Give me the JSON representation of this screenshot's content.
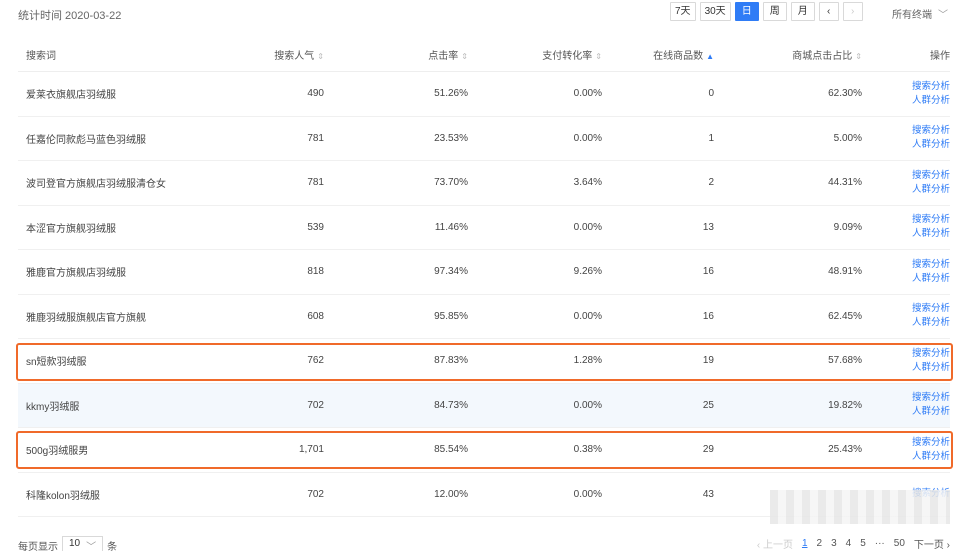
{
  "header": {
    "stat_time": "统计时间 2020-03-22",
    "ranges": [
      "7天",
      "30天",
      "日",
      "周",
      "月"
    ],
    "active_range": "日",
    "prev": "‹",
    "next": "›",
    "terminal": "所有终端"
  },
  "columns": {
    "keyword": "搜索词",
    "popularity": "搜索人气",
    "click_rate": "点击率",
    "pay_rate": "支付转化率",
    "online_products": "在线商品数",
    "mall_click": "商城点击占比",
    "ops": "操作"
  },
  "ops_links": {
    "search": "搜索分析",
    "crowd": "人群分析"
  },
  "rows": [
    {
      "keyword": "爱莱衣旗舰店羽绒服",
      "popularity": "490",
      "click_rate": "51.26%",
      "pay_rate": "0.00%",
      "products": "0",
      "mall": "62.30%"
    },
    {
      "keyword": "任嘉伦同款彪马蓝色羽绒服",
      "popularity": "781",
      "click_rate": "23.53%",
      "pay_rate": "0.00%",
      "products": "1",
      "mall": "5.00%"
    },
    {
      "keyword": "波司登官方旗舰店羽绒服清仓女",
      "popularity": "781",
      "click_rate": "73.70%",
      "pay_rate": "3.64%",
      "products": "2",
      "mall": "44.31%"
    },
    {
      "keyword": "本涩官方旗舰羽绒服",
      "popularity": "539",
      "click_rate": "11.46%",
      "pay_rate": "0.00%",
      "products": "13",
      "mall": "9.09%"
    },
    {
      "keyword": "雅鹿官方旗舰店羽绒服",
      "popularity": "818",
      "click_rate": "97.34%",
      "pay_rate": "9.26%",
      "products": "16",
      "mall": "48.91%"
    },
    {
      "keyword": "雅鹿羽绒服旗舰店官方旗舰",
      "popularity": "608",
      "click_rate": "95.85%",
      "pay_rate": "0.00%",
      "products": "16",
      "mall": "62.45%"
    },
    {
      "keyword": "sn短款羽绒服",
      "popularity": "762",
      "click_rate": "87.83%",
      "pay_rate": "1.28%",
      "products": "19",
      "mall": "57.68%"
    },
    {
      "keyword": "kkmy羽绒服",
      "popularity": "702",
      "click_rate": "84.73%",
      "pay_rate": "0.00%",
      "products": "25",
      "mall": "19.82%"
    },
    {
      "keyword": "500g羽绒服男",
      "popularity": "1,701",
      "click_rate": "85.54%",
      "pay_rate": "0.38%",
      "products": "29",
      "mall": "25.43%"
    },
    {
      "keyword": "科隆kolon羽绒服",
      "popularity": "702",
      "click_rate": "12.00%",
      "pay_rate": "0.00%",
      "products": "43",
      "mall": ""
    }
  ],
  "footer": {
    "per_page_prefix": "每页显示",
    "per_page_value": "10",
    "per_page_suffix": "条",
    "prev_page": "‹ 上一页",
    "pages": [
      "1",
      "2",
      "3",
      "4",
      "5"
    ],
    "ellipsis": "···",
    "last_page": "50",
    "next_page": "下一页 ›"
  },
  "colors": {
    "accent": "#2f7cf6",
    "highlight": "#f06a2a"
  }
}
